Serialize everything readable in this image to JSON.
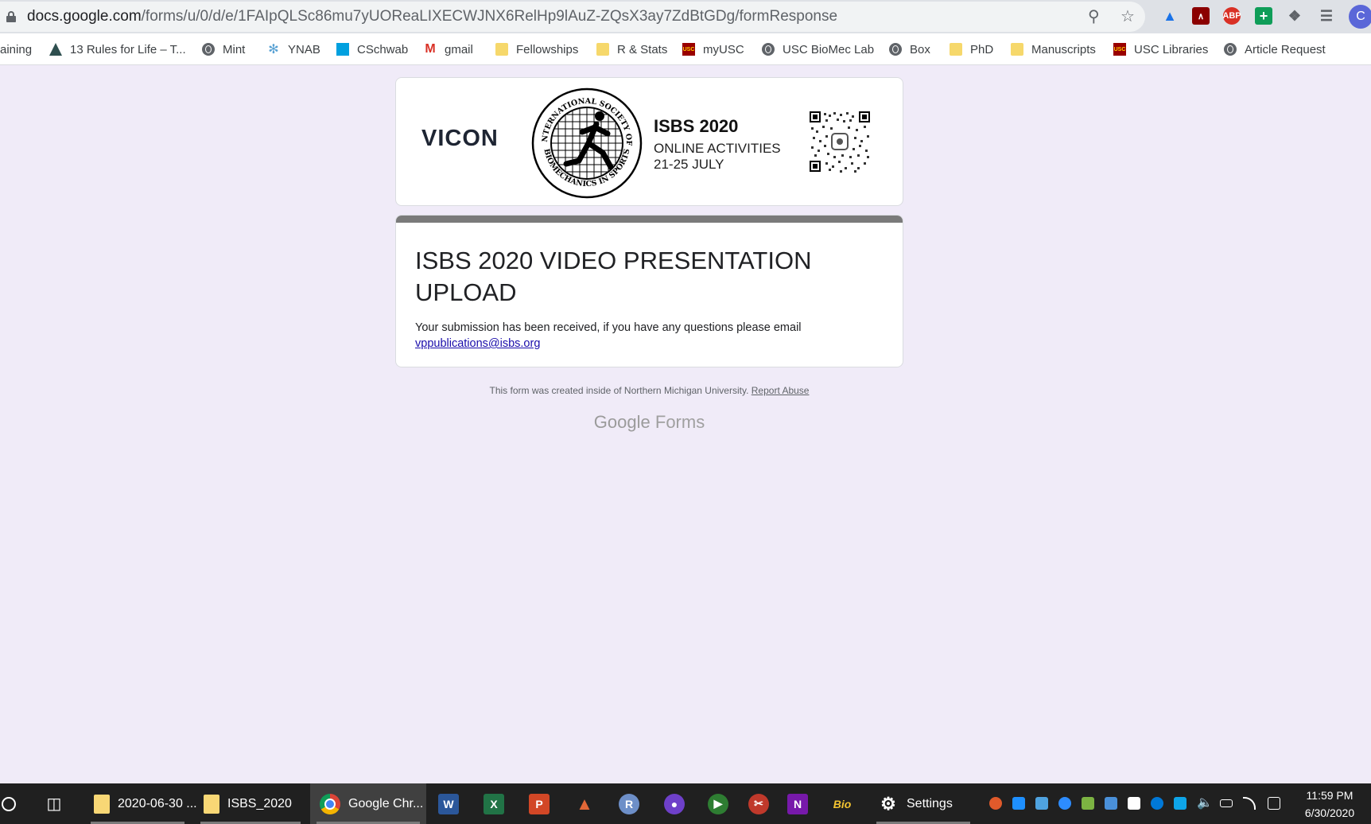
{
  "browser": {
    "url_host": "docs.google.com",
    "url_path": "/forms/u/0/d/e/1FAIpQLSc86mu7yUOReaLIXECWJNX6RelHp9lAuZ-ZQsX3ay7ZdBtGDg/formResponse",
    "extensions": [
      "ABP"
    ],
    "profile_initial": "C"
  },
  "bookmarks": [
    {
      "label": "aining",
      "icon": "none"
    },
    {
      "label": "13 Rules for Life – T...",
      "icon": "rules-icon"
    },
    {
      "label": "Mint",
      "icon": "globe-icon"
    },
    {
      "label": "YNAB",
      "icon": "ynab-icon"
    },
    {
      "label": "CSchwab",
      "icon": "schwab-icon"
    },
    {
      "label": "gmail",
      "icon": "gmail-icon"
    },
    {
      "label": "Fellowships",
      "icon": "folder-icon"
    },
    {
      "label": "R & Stats",
      "icon": "folder-icon"
    },
    {
      "label": "myUSC",
      "icon": "usc-icon"
    },
    {
      "label": "USC BioMec Lab",
      "icon": "globe-icon"
    },
    {
      "label": "Box",
      "icon": "globe-icon"
    },
    {
      "label": "PhD",
      "icon": "folder-icon"
    },
    {
      "label": "Manuscripts",
      "icon": "folder-icon"
    },
    {
      "label": "USC Libraries",
      "icon": "usc-icon"
    },
    {
      "label": "Article Request",
      "icon": "globe-icon"
    }
  ],
  "banner": {
    "sponsor": "VICON",
    "seal_ring_top": "INTERNATIONAL SOCIETY OF",
    "seal_ring_bottom": "BIOMECHANICS IN SPORTS",
    "title": "ISBS 2020",
    "line1": "ONLINE ACTIVITIES",
    "line2": "21-25 JULY"
  },
  "form": {
    "title": "ISBS 2020 VIDEO PRESENTATION UPLOAD",
    "message": "Your submission has been received, if you have any questions please email",
    "email": "vppublications@isbs.org",
    "accent_color": "#7a7a7a"
  },
  "footer": {
    "note": "This form was created inside of Northern Michigan University.",
    "report": "Report Abuse",
    "brand_google": "Google",
    "brand_forms": "Forms"
  },
  "taskbar": {
    "items": [
      {
        "label": "2020-06-30 ...",
        "icon": "folder-icon"
      },
      {
        "label": "ISBS_2020",
        "icon": "folder-icon"
      },
      {
        "label": "Google Chr...",
        "icon": "chrome-icon"
      },
      {
        "label": "Settings",
        "icon": "gear-icon"
      }
    ],
    "pinned_labels": {
      "word": "W",
      "excel": "X",
      "powerpoint": "P",
      "r": "R",
      "onenote": "N",
      "bio": "Bio"
    },
    "time": "11:59 PM",
    "date": "6/30/2020"
  }
}
